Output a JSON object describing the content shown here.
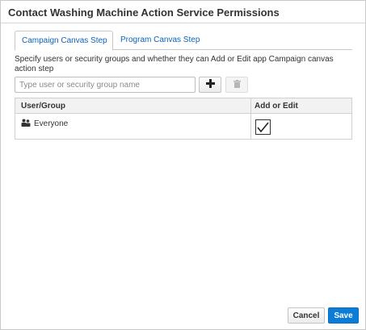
{
  "dialog": {
    "title": "Contact Washing Machine Action Service Permissions"
  },
  "tabs": [
    {
      "label": "Campaign Canvas Step",
      "active": true
    },
    {
      "label": "Program Canvas Step",
      "active": false
    }
  ],
  "description": "Specify users or security groups and whether they can Add or Edit app Campaign canvas action step",
  "search": {
    "placeholder": "Type user or security group name",
    "value": ""
  },
  "toolbar": {
    "add_icon": "plus-icon",
    "delete_icon": "trash-icon",
    "delete_enabled": false
  },
  "table": {
    "columns": [
      "User/Group",
      "Add or Edit"
    ],
    "rows": [
      {
        "icon": "group-icon",
        "name": "Everyone",
        "add_or_edit": true
      }
    ]
  },
  "footer": {
    "cancel_label": "Cancel",
    "save_label": "Save"
  },
  "colors": {
    "accent": "#0b7dd6",
    "link": "#0b63b8"
  }
}
